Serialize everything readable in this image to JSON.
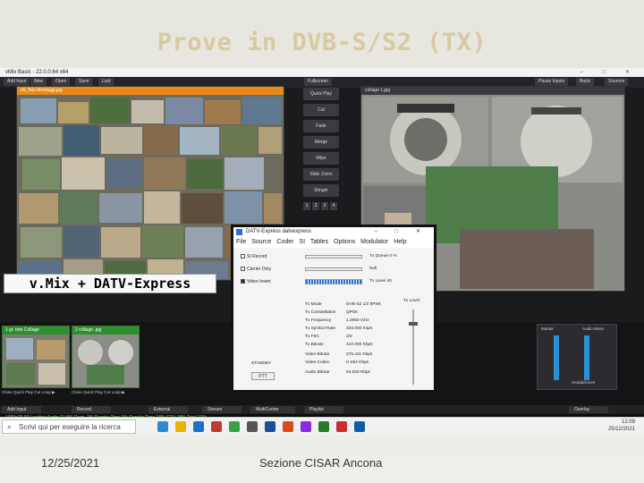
{
  "slide": {
    "title": "Prove in DVB-S/S2 (TX)",
    "caption": "v.Mix + DATV-Express",
    "footer_date": "12/25/2021",
    "footer_org": "Sezione CISAR Ancona"
  },
  "vmix": {
    "window_title": "vMix Basic - 22.0.0.64 x64",
    "window_controls": "– □ ✕",
    "menu": [
      "Add Input",
      "New",
      "Open",
      "Save",
      "Last"
    ],
    "fullscreen": "Fullscreen",
    "right_menu": [
      "Pause Inputs",
      "Basic",
      "Sources"
    ],
    "preview_title": "dir_foto Montaggi.jpg",
    "output_title": "collage 1.jpg",
    "transitions": [
      "Quick Play",
      "Cut",
      "Fade",
      "Merge",
      "Wipe",
      "Slide Zoom",
      "Stinger"
    ],
    "transition_numbers": [
      "1",
      "2",
      "3",
      "4"
    ],
    "input1_title": "1 gr. foto Collage",
    "input2_title": "2 collage .jpg",
    "input_controls": "Close  Quick Play  Cut  Loop  ▶",
    "bottom_buttons": [
      "Add Input",
      "Record",
      "External",
      "Stream",
      "MultiCorder",
      "Playlist",
      "Overlay"
    ],
    "status": "1080p25.00    Loading Audio (1)    BK Conn. 3%    Render Time 3% Render Time 18% CPU 18%   Total 10%",
    "audio_mixer": "Audio Mixer",
    "master": "Master",
    "headphones": "Headphones",
    "preview_tag": "Preview"
  },
  "taskbar": {
    "search": "Scrivi qui per eseguire la ricerca",
    "time": "12:09",
    "date": "25/12/2021"
  },
  "datv": {
    "title": "DATV-Express   datvexpress",
    "controls": "– □ ✕",
    "menu": [
      "File",
      "Source",
      "Coder",
      "SI Tables",
      "Options",
      "Modulator",
      "Help"
    ],
    "checks": [
      "SI Record",
      "Carrier Only",
      "Video Insert"
    ],
    "tx_lines": [
      "Tx Queue 0 %",
      "Null",
      "Tx Level 40"
    ],
    "tx_level": "Tx Level",
    "params": [
      {
        "k": "Tx Mode",
        "v": "DVB-S2 1/2 8PSK"
      },
      {
        "k": "Tx Constellation",
        "v": "QPSK"
      },
      {
        "k": "Tx Frequency",
        "v": "1.2960 GHz"
      },
      {
        "k": "Tx Symbol Rate",
        "v": "333.000 Ksps"
      },
      {
        "k": "Tx FEC",
        "v": "2/3"
      },
      {
        "k": "Tx Bitrate",
        "v": "410.000 Kbps"
      },
      {
        "k": "Video Bitrate",
        "v": "275.411 Kbps"
      },
      {
        "k": "Video Codec",
        "v": "H.264 Kbps"
      },
      {
        "k": "Audio Bitrate",
        "v": "64.000 Kbps"
      }
    ],
    "standby": "STANDBY",
    "ptt": "PTT"
  }
}
